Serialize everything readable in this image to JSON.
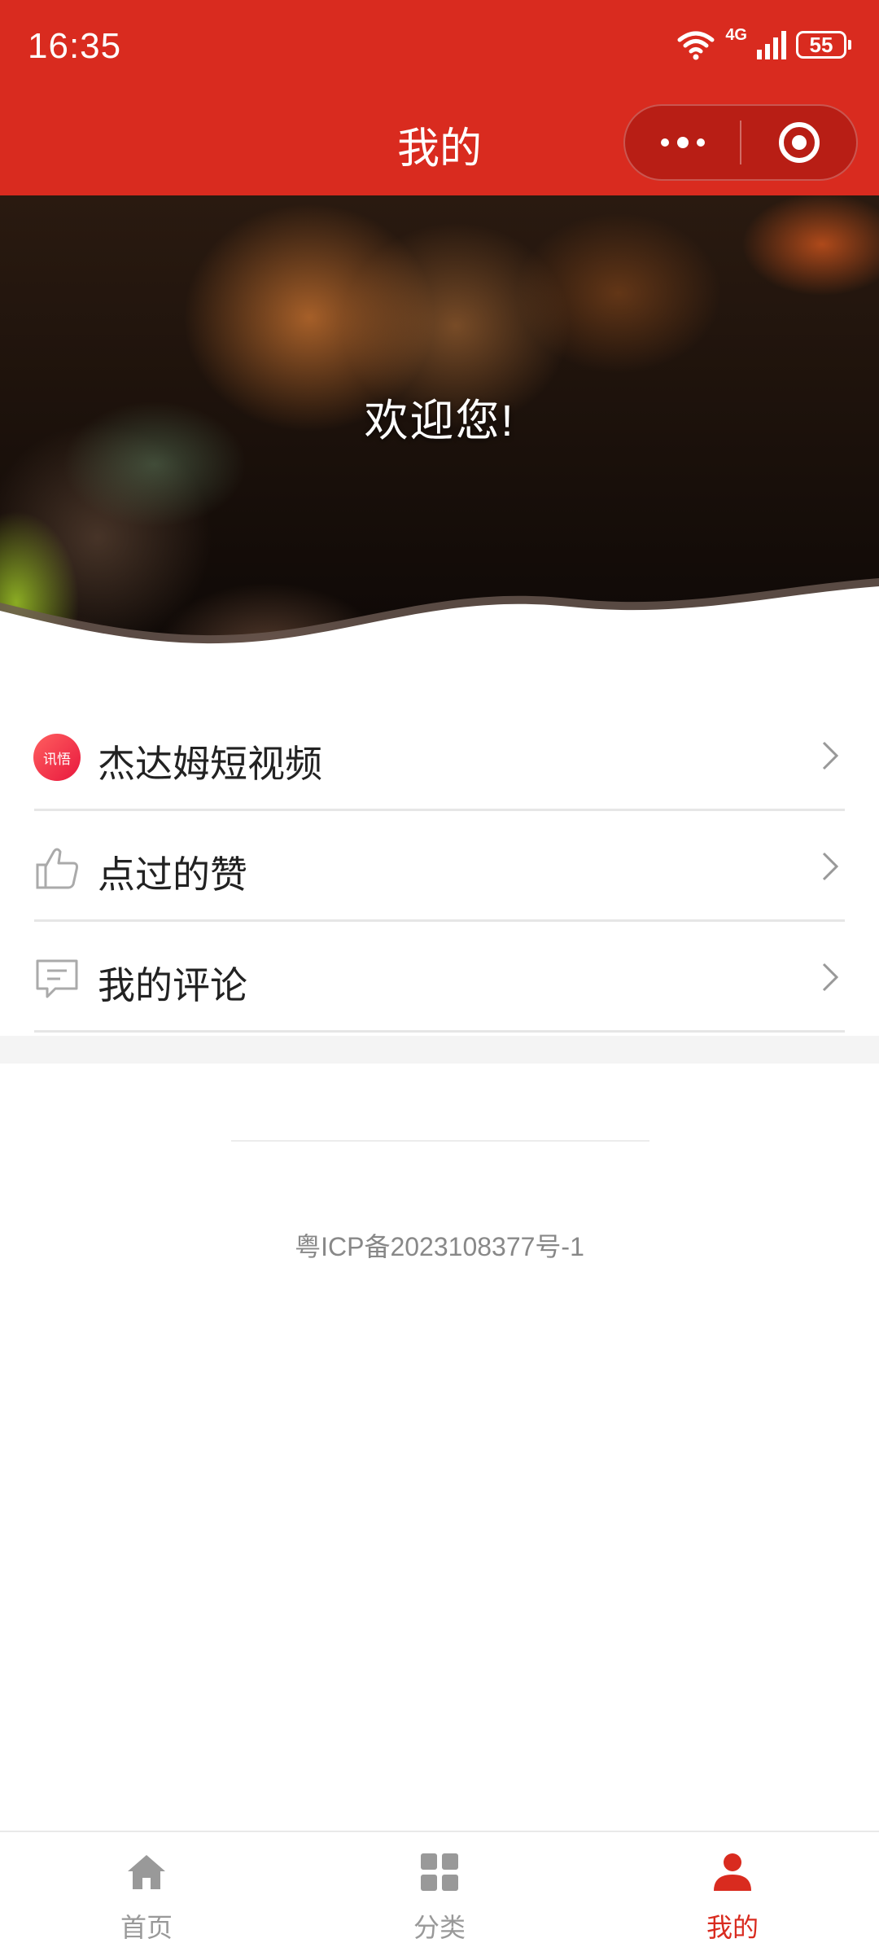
{
  "status_bar": {
    "time": "16:35",
    "battery": "55",
    "network": "4G"
  },
  "nav": {
    "title": "我的"
  },
  "hero": {
    "welcome": "欢迎您!"
  },
  "menu": [
    {
      "label": "杰达姆短视频",
      "icon": "app-logo-icon",
      "icon_text": "讯悟"
    },
    {
      "label": "点过的赞",
      "icon": "thumbs-up-icon"
    },
    {
      "label": "我的评论",
      "icon": "comment-icon"
    }
  ],
  "footer": {
    "icp": "粤ICP备2023108377号-1"
  },
  "tabbar": [
    {
      "label": "首页",
      "icon": "home-icon",
      "active": false
    },
    {
      "label": "分类",
      "icon": "grid-icon",
      "active": false
    },
    {
      "label": "我的",
      "icon": "user-icon",
      "active": true
    }
  ],
  "colors": {
    "primary": "#d92b1f",
    "text": "#222222",
    "muted": "#999999"
  }
}
